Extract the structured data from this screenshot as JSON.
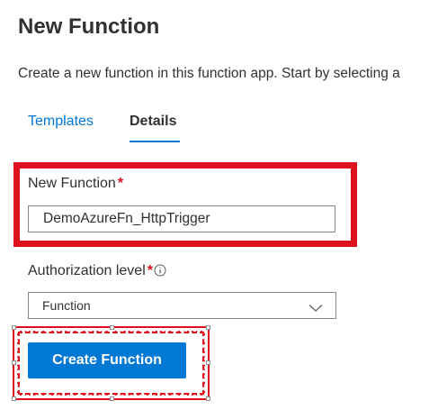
{
  "page": {
    "title": "New Function",
    "description": "Create a new function in this function app. Start by selecting a"
  },
  "tabs": [
    {
      "label": "Templates",
      "selected": false
    },
    {
      "label": "Details",
      "selected": true
    }
  ],
  "form": {
    "name_label": "New Function",
    "name_required_marker": "*",
    "name_value": "DemoAzureFn_HttpTrigger",
    "auth_label": "Authorization level",
    "auth_required_marker": "*",
    "auth_info_icon": "info-icon",
    "auth_value": "Function",
    "auth_dropdown_icon": "chevron-down-icon"
  },
  "actions": {
    "create_label": "Create Function"
  },
  "colors": {
    "accent": "#0078d4",
    "highlight": "#e0111f",
    "text": "#323130"
  }
}
